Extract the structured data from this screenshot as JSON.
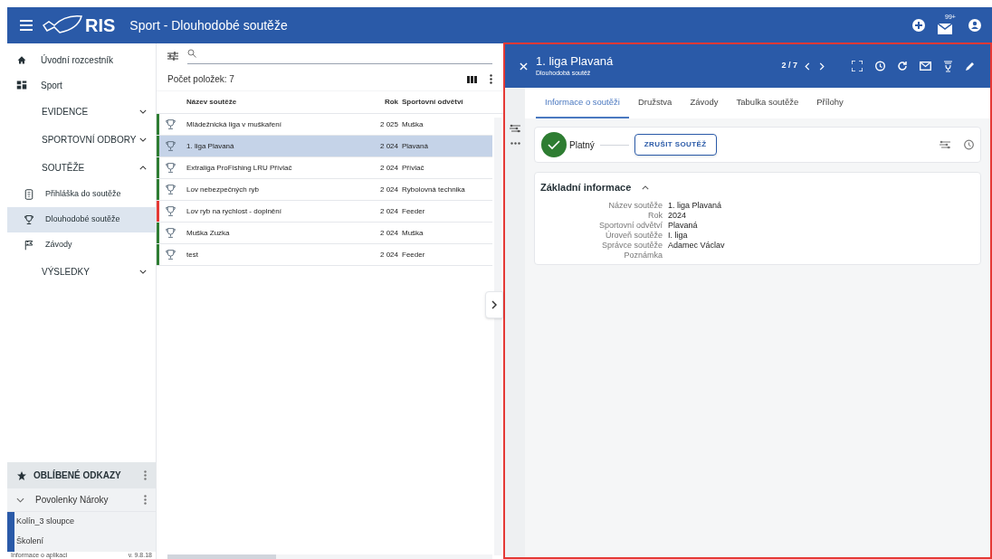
{
  "app_bar": {
    "logo": "RIS",
    "title": "Sport - Dlouhodobé soutěže",
    "mail_badge": "99+"
  },
  "sidebar": {
    "items": [
      {
        "kind": "link",
        "label": "Úvodní rozcestník",
        "selected": false
      },
      {
        "kind": "link",
        "label": "Sport",
        "selected": false
      },
      {
        "kind": "group",
        "label": "EVIDENCE",
        "expanded": false
      },
      {
        "kind": "group",
        "label": "SPORTOVNÍ ODBORY",
        "expanded": false
      },
      {
        "kind": "group",
        "label": "SOUTĚŽE",
        "expanded": true
      },
      {
        "kind": "sub",
        "label": "Přihláška do soutěže",
        "selected": false
      },
      {
        "kind": "sub",
        "label": "Dlouhodobé soutěže",
        "selected": true
      },
      {
        "kind": "sub",
        "label": "Závody",
        "selected": false
      },
      {
        "kind": "group",
        "label": "VÝSLEDKY",
        "expanded": false
      }
    ],
    "favorites": {
      "title": "OBLÍBENÉ ODKAZY",
      "folder": "Povolenky Nároky",
      "folder_expanded": false,
      "links": [
        "Kolín_3 sloupce",
        "Školení"
      ]
    },
    "footer": {
      "info": "Informace o aplikaci",
      "version": "v. 9.8.18"
    }
  },
  "list": {
    "count": "Počet položek: 7",
    "columns": [
      "Název soutěže",
      "Rok",
      "Sportovní odvětví"
    ],
    "rows": [
      {
        "name": "Mládežnická liga v muškaření",
        "year": "2 025",
        "sport": "Muška",
        "color": "#2e7d32",
        "selected": false
      },
      {
        "name": "1. liga Plavaná",
        "year": "2 024",
        "sport": "Plavaná",
        "color": "#2e7d32",
        "selected": true
      },
      {
        "name": "Extraliga ProFishing LRU Přívlač",
        "year": "2 024",
        "sport": "Přívlač",
        "color": "#2e7d32",
        "selected": false
      },
      {
        "name": "Lov nebezpečných ryb",
        "year": "2 024",
        "sport": "Rybolovná technika",
        "color": "#2e7d32",
        "selected": false
      },
      {
        "name": "Lov ryb na rychlost - doplnění",
        "year": "2 024",
        "sport": "Feeder",
        "color": "#e53935",
        "selected": false
      },
      {
        "name": "Muška Zuzka",
        "year": "2 024",
        "sport": "Muška",
        "color": "#2e7d32",
        "selected": false
      },
      {
        "name": "test",
        "year": "2 024",
        "sport": "Feeder",
        "color": "#2e7d32",
        "selected": false
      }
    ]
  },
  "detail": {
    "title": "1. liga Plavaná",
    "subtitle": "Dlouhodobá soutěž",
    "pager": "2 / 7",
    "tabs": [
      {
        "label": "Informace o soutěži",
        "selected": true
      },
      {
        "label": "Družstva",
        "selected": false
      },
      {
        "label": "Závody",
        "selected": false
      },
      {
        "label": "Tabulka soutěže",
        "selected": false
      },
      {
        "label": "Přílohy",
        "selected": false
      }
    ],
    "status": "Platný",
    "cancel_button": "ZRUŠIT SOUTĚŽ",
    "section": {
      "title": "Základní informace",
      "expanded": true,
      "fields": [
        {
          "label": "Název soutěže",
          "value": "1. liga Plavaná"
        },
        {
          "label": "Rok",
          "value": "2024"
        },
        {
          "label": "Sportovní odvětví",
          "value": "Plavaná"
        },
        {
          "label": "Úroveň soutěže",
          "value": "I. liga"
        },
        {
          "label": "Správce soutěže",
          "value": "Adamec Václav"
        },
        {
          "label": "Poznámka"
        }
      ]
    }
  }
}
